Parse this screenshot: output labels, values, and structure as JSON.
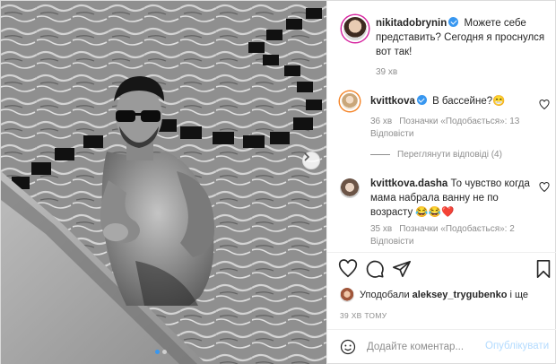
{
  "post": {
    "owner": "nikitadobrynin",
    "caption": "Можете себе представить? Сегодня я проснулся вот так!",
    "caption_time": "39 хв"
  },
  "comments": [
    {
      "user": "kvittkova",
      "verified": true,
      "text": "В бассейне?😁",
      "time": "36 хв",
      "likes": "Позначки «Подобається»: 13",
      "reply": "Відповісти",
      "view_replies": "Переглянути відповіді (4)"
    },
    {
      "user": "kvittkova.dasha",
      "verified": false,
      "text": "То чувство когда мама набрала ванну не по возрасту 😂😂❤️",
      "time": "35 хв",
      "likes": "Позначки «Подобається»: 2",
      "reply": "Відповісти"
    }
  ],
  "liked_by": {
    "prefix": "Уподобали",
    "user": "aleksey_trygubenko",
    "suffix": "і ще"
  },
  "time_ago": "39 ХВ ТОМУ",
  "add_comment": {
    "placeholder": "Додайте коментар...",
    "post_label": "Опублікувати"
  },
  "colors": {
    "accent": "#3897f0",
    "post_button_disabled": "#b3dbff",
    "meta_text": "#8e8e8e"
  },
  "icons": {
    "like": "heart-icon",
    "comment": "comment-bubble-icon",
    "share": "paper-plane-icon",
    "save": "bookmark-icon",
    "emoji": "smiley-icon",
    "carousel_next": "chevron-right-icon"
  },
  "carousel": {
    "slides": 2,
    "active": 1
  }
}
